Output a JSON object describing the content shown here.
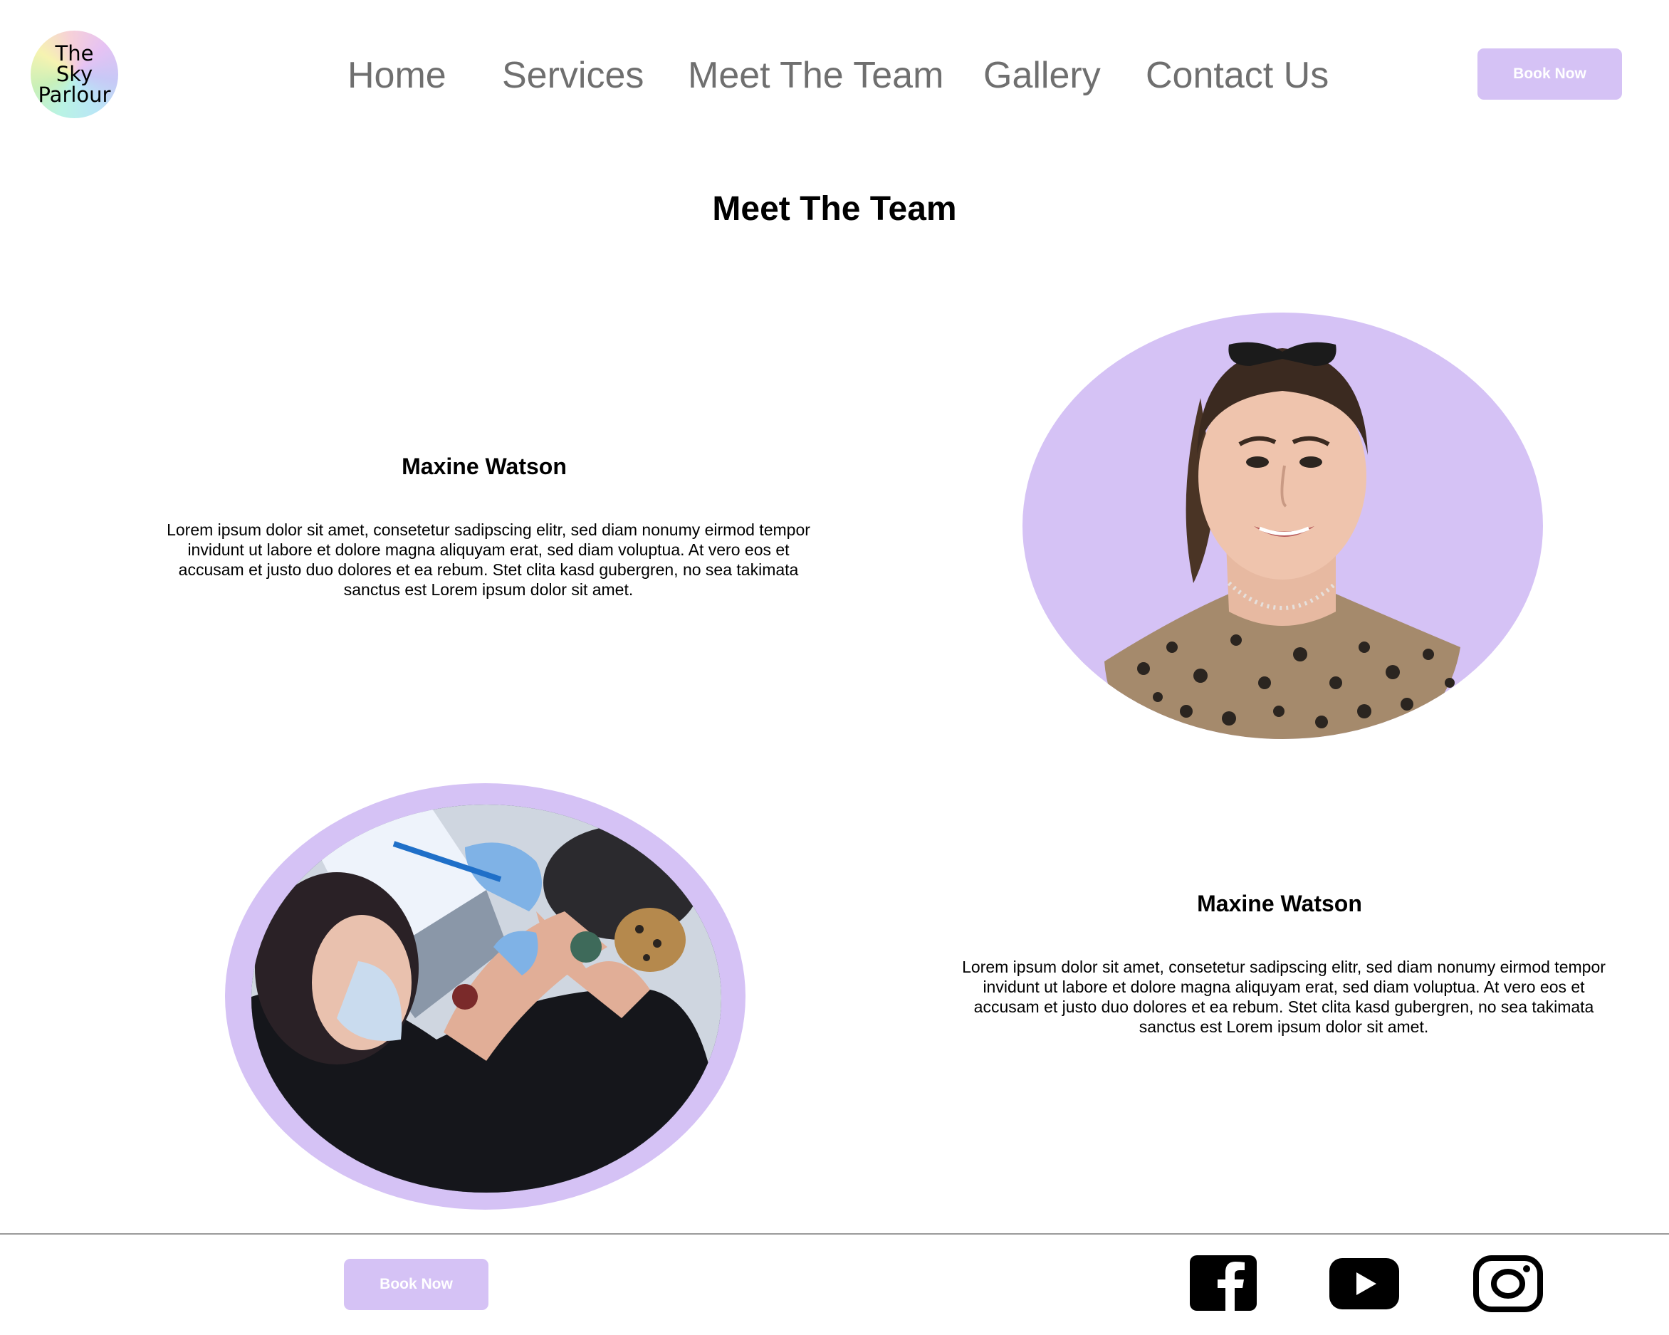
{
  "brand": {
    "logo_text": "The Sky Parlour"
  },
  "nav": {
    "home": "Home",
    "services": "Services",
    "team": "Meet The Team",
    "gallery": "Gallery",
    "contact": "Contact Us"
  },
  "header": {
    "book_label": "Book Now"
  },
  "page": {
    "title": "Meet The Team"
  },
  "members": [
    {
      "name": "Maxine Watson",
      "bio": "Lorem ipsum dolor sit amet, consetetur sadipscing elitr, sed diam nonumy eirmod tempor invidunt ut labore et dolore magna aliquyam erat, sed diam voluptua. At vero eos et accusam et justo duo dolores et ea rebum. Stet clita kasd gubergren, no sea takimata sanctus est Lorem ipsum dolor sit amet."
    },
    {
      "name": "Maxine Watson",
      "bio": "Lorem ipsum dolor sit amet, consetetur sadipscing elitr, sed diam nonumy eirmod tempor invidunt ut labore et dolore magna aliquyam erat, sed diam voluptua. At vero eos et accusam et justo duo dolores et ea rebum. Stet clita kasd gubergren, no sea takimata sanctus est Lorem ipsum dolor sit amet."
    }
  ],
  "footer": {
    "book_label": "Book Now"
  },
  "social": [
    "facebook-icon",
    "youtube-icon",
    "instagram-icon"
  ],
  "colors": {
    "accent": "#d5c2f5",
    "nav_text": "#6f6f6f"
  }
}
